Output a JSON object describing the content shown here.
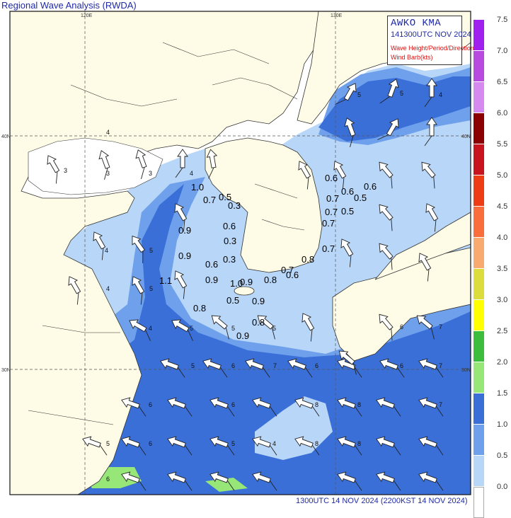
{
  "title": "Regional Wave Analysis (RWDA)",
  "info_box": {
    "agency": "AWKO  KMA",
    "time": "141300UTC NOV 2024",
    "line1": "Wave Height/Period/Direction",
    "line2": "Wind Barb(kts)"
  },
  "footer": "1300UTC 14 NOV 2024 (2200KST 14 NOV 2024)",
  "grid_labels": {
    "lon_120": "120E",
    "lon_130": "130E",
    "lat_40_left": "40N",
    "lat_30_left": "30N",
    "lat_40_right": "40N",
    "lat_30_right": "30N"
  },
  "legend": {
    "labels": [
      "7.5",
      "7.0",
      "6.5",
      "6.0",
      "5.5",
      "5.0",
      "4.5",
      "4.0",
      "3.5",
      "3.0",
      "2.5",
      "2.0",
      "1.5",
      "1.0",
      "0.5",
      "0.0"
    ],
    "colors": [
      "#a020f0",
      "#b84ae0",
      "#d68af0",
      "#8b0000",
      "#c8141e",
      "#ee3c14",
      "#fa6e3c",
      "#f9aa6e",
      "#dcdc3c",
      "#ffff00",
      "#3cbe3c",
      "#96e678",
      "#3a6fd8",
      "#6fa0ec",
      "#b8d6f8",
      "#ffffff"
    ]
  },
  "colors": {
    "land": "#fefce6",
    "sea_calm": "#ffffff",
    "sea_light": "#b8d6f8",
    "sea_medium": "#6fa0ec",
    "sea_strong": "#3a6fd8",
    "sea_green": "#96e678"
  },
  "buoy_values": [
    {
      "id": "b1",
      "text": "1.0"
    },
    {
      "id": "b2",
      "text": "0.5"
    },
    {
      "id": "b3",
      "text": "0.7"
    },
    {
      "id": "b4",
      "text": "0.3"
    },
    {
      "id": "b5",
      "text": "0.9"
    },
    {
      "id": "b6",
      "text": "0.6"
    },
    {
      "id": "b7",
      "text": "0.9"
    },
    {
      "id": "b8",
      "text": "0.3"
    },
    {
      "id": "b9",
      "text": "0.6"
    },
    {
      "id": "b10",
      "text": "0.3"
    },
    {
      "id": "b11",
      "text": "1.1"
    },
    {
      "id": "b12",
      "text": "0.9"
    },
    {
      "id": "b13",
      "text": "1.0"
    },
    {
      "id": "b14",
      "text": "0.9"
    },
    {
      "id": "b15",
      "text": "0.8"
    },
    {
      "id": "b16",
      "text": "0.5"
    },
    {
      "id": "b17",
      "text": "0.9"
    },
    {
      "id": "b18",
      "text": "0.8"
    },
    {
      "id": "b19",
      "text": "0.8"
    },
    {
      "id": "b20",
      "text": "0.9"
    },
    {
      "id": "b21",
      "text": "0.6"
    },
    {
      "id": "b22",
      "text": "0.6"
    },
    {
      "id": "b23",
      "text": "0.5"
    },
    {
      "id": "b24",
      "text": "0.6"
    },
    {
      "id": "b25",
      "text": "0.7"
    },
    {
      "id": "b26",
      "text": "0.7"
    },
    {
      "id": "b27",
      "text": "0.5"
    },
    {
      "id": "b28",
      "text": "0.7"
    },
    {
      "id": "b29",
      "text": "0.7"
    },
    {
      "id": "b30",
      "text": "0.7"
    },
    {
      "id": "b31",
      "text": "0.8"
    },
    {
      "id": "b32",
      "text": "0.6"
    }
  ],
  "period_labels": [
    "5",
    "5",
    "4",
    "4",
    "3",
    "3",
    "3",
    "4",
    "4",
    "5",
    "5",
    "4",
    "4",
    "5",
    "5",
    "5",
    "6",
    "7",
    "6",
    "5",
    "6",
    "8",
    "8",
    "7",
    "6",
    "6",
    "8",
    "6",
    "8",
    "6",
    "4",
    "5",
    "5",
    "7",
    "6",
    "7"
  ]
}
